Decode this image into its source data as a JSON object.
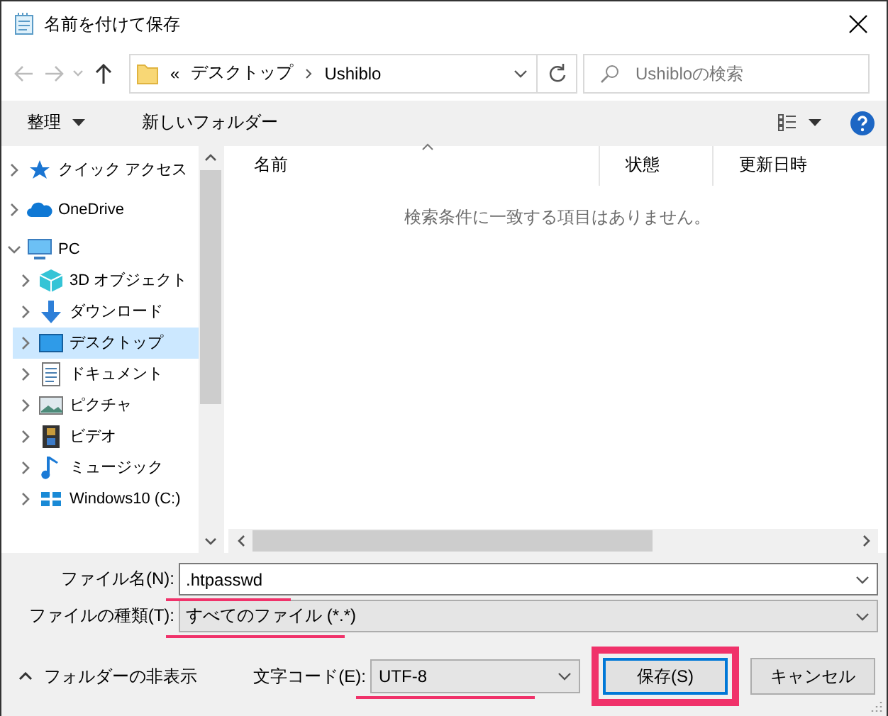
{
  "window": {
    "title": "名前を付けて保存"
  },
  "address_bar": {
    "overflow": "«",
    "path": [
      "デスクトップ",
      "Ushiblo"
    ]
  },
  "search": {
    "placeholder": "Ushibloの検索"
  },
  "toolbar": {
    "organize": "整理",
    "new_folder": "新しいフォルダー"
  },
  "nav_pane": {
    "items": [
      {
        "label": "クイック アクセス",
        "kind": "star",
        "expanded": false,
        "selected": false
      },
      {
        "label": "OneDrive",
        "kind": "cloud",
        "expanded": false,
        "selected": false
      },
      {
        "label": "PC",
        "kind": "pc",
        "expanded": true,
        "selected": false,
        "children": [
          {
            "label": "3D オブジェクト",
            "kind": "cube",
            "expanded": false,
            "selected": false
          },
          {
            "label": "ダウンロード",
            "kind": "download",
            "expanded": false,
            "selected": false
          },
          {
            "label": "デスクトップ",
            "kind": "desktop",
            "expanded": false,
            "selected": true
          },
          {
            "label": "ドキュメント",
            "kind": "document",
            "expanded": false,
            "selected": false
          },
          {
            "label": "ピクチャ",
            "kind": "picture",
            "expanded": false,
            "selected": false
          },
          {
            "label": "ビデオ",
            "kind": "video",
            "expanded": false,
            "selected": false
          },
          {
            "label": "ミュージック",
            "kind": "music",
            "expanded": false,
            "selected": false
          },
          {
            "label": "Windows10 (C:)",
            "kind": "drive",
            "expanded": false,
            "selected": false
          }
        ]
      }
    ]
  },
  "file_list": {
    "columns": [
      "名前",
      "状態",
      "更新日時"
    ],
    "empty_message": "検索条件に一致する項目はありません。"
  },
  "file_name": {
    "label": "ファイル名(N):",
    "value": ".htpasswd"
  },
  "file_type": {
    "label": "ファイルの種類(T):",
    "value": "すべてのファイル (*.*)"
  },
  "hide_folders": "フォルダーの非表示",
  "encoding": {
    "label": "文字コード(E):",
    "value": "UTF-8"
  },
  "buttons": [
    {
      "label": "保存(S)",
      "kind": "default"
    },
    {
      "label": "キャンセル",
      "kind": "normal"
    }
  ]
}
